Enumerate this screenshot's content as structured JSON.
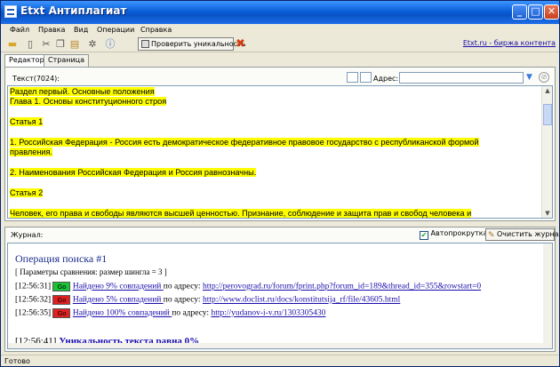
{
  "window": {
    "title": "Etxt Антиплагиат",
    "minimize": "_",
    "maximize": "□",
    "close": "✕"
  },
  "menu": {
    "items": [
      "Файл",
      "Правка",
      "Вид",
      "Операции",
      "Справка"
    ]
  },
  "toolbar": {
    "check_label": "Проверить уникальность",
    "etxt_link": "Etxt.ru - биржа контента"
  },
  "tabs": [
    {
      "label": "Редактор",
      "active": true
    },
    {
      "label": "Страница",
      "active": false
    }
  ],
  "editor": {
    "text_label": "Текст(7024):",
    "address_label": "Адрес:",
    "address_value": "",
    "lines": [
      {
        "text": "Раздел первый. Основные положения",
        "highlight": true
      },
      {
        "text": "Глава 1. Основы конституционного строя",
        "highlight": true
      },
      {
        "text": "",
        "highlight": false
      },
      {
        "text": "Статья 1",
        "highlight": true
      },
      {
        "text": "",
        "highlight": false
      },
      {
        "text": "1. Российская Федерация - Россия есть демократическое федеративное правовое государство с республиканской формой",
        "highlight": true
      },
      {
        "text": "правления.",
        "highlight": true
      },
      {
        "text": "",
        "highlight": false
      },
      {
        "text": "2. Наименования Российская Федерация и Россия равнозначны.",
        "highlight": true
      },
      {
        "text": "",
        "highlight": false
      },
      {
        "text": "Статья 2",
        "highlight": true
      },
      {
        "text": "",
        "highlight": false
      },
      {
        "text": "Человек, его права и свободы являются высшей ценностью. Признание, соблюдение и защита прав и свобод человека и",
        "highlight": true
      }
    ]
  },
  "journal": {
    "label": "Журнал:",
    "autoscroll_label": "Автопрокрутка",
    "autoscroll_checked": true,
    "clear_label": "Очистить журнал",
    "operation_title": "Операция поиска #1",
    "params": "[ Параметры сравнения: размер шингла = 3 ]",
    "entries": [
      {
        "time": "[12:56:31]",
        "badge": "Go",
        "badge_color": "#19c337",
        "found": "Найдено 9% совпадений ",
        "by_address": "по адресу:",
        "url": "http://perovograd.ru/forum/fprint.php?forum_id=189&thread_id=355&rowstart=0"
      },
      {
        "time": "[12:56:32]",
        "badge": "Go",
        "badge_color": "#e02020",
        "found": "Найдено 5% совпадений ",
        "by_address": "по адресу:",
        "url": "http://www.doclist.ru/docs/konstitutsija_rf/file/43605.html"
      },
      {
        "time": "[12:56:35]",
        "badge": "Go",
        "badge_color": "#e02020",
        "found": "Найдено 100% совпадений ",
        "by_address": "по адресу:",
        "url": "http://yudanov-i-v.ru/1303305430"
      }
    ],
    "uniqueness_time": "[12:56:41]",
    "uniqueness_text": "Уникальность текста равна 0%"
  },
  "status": {
    "text": "Готово"
  }
}
